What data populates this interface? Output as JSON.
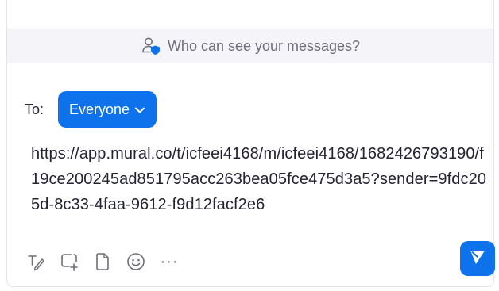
{
  "visibility_bar": {
    "text": "Who can see your messages?",
    "icon": "person-shield-icon"
  },
  "recipient": {
    "to_label": "To:",
    "selected": "Everyone"
  },
  "composer": {
    "message_text": "https://app.mural.co/t/icfeei4168/m/icfeei4168/1682426793190/f19ce200245ad851795acc263bea05fce475d3a5?sender=9fdc205d-8c33-4faa-9612-f9d12facf2e6"
  },
  "toolbar": {
    "icons": [
      "format-text-icon",
      "screenshot-icon",
      "file-icon",
      "emoji-icon",
      "more-icon"
    ],
    "more_label": "···",
    "send_icon": "send-icon"
  },
  "colors": {
    "accent": "#0e72ed",
    "muted": "#6e6e78",
    "text": "#232333",
    "bar_bg": "#f5f5f9"
  }
}
